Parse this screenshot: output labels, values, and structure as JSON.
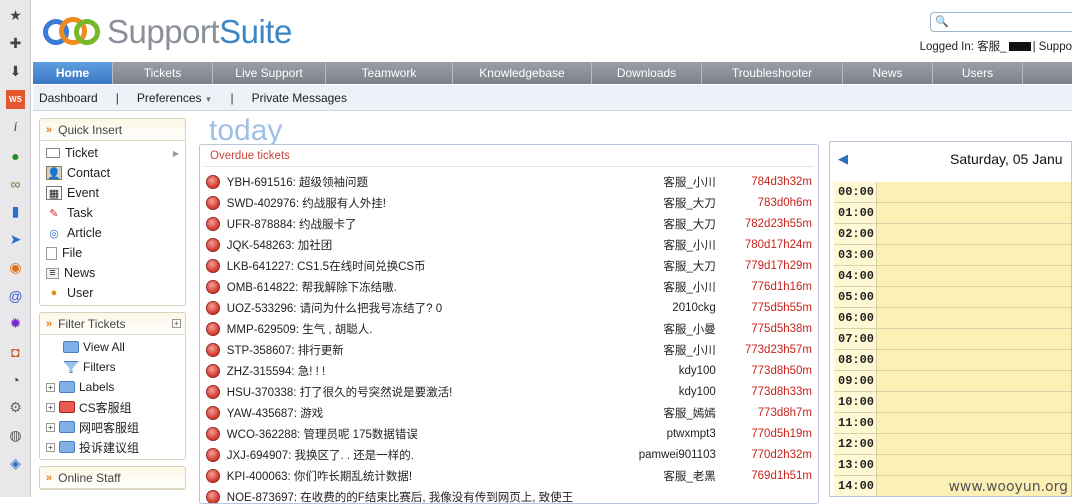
{
  "brand": {
    "name_a": "Support",
    "name_b": "Suite"
  },
  "header": {
    "search_placeholder": "",
    "logged_in_label": "Logged In: 客服_",
    "logged_in_tail": "| Suppo"
  },
  "nav": {
    "tabs": [
      "Home",
      "Tickets",
      "Live Support",
      "Teamwork",
      "Knowledgebase",
      "Downloads",
      "Troubleshooter",
      "News",
      "Users"
    ]
  },
  "subnav": {
    "items": [
      "Dashboard",
      "Preferences",
      "Private Messages"
    ]
  },
  "quick_insert": {
    "title": "Quick Insert",
    "items": [
      "Ticket",
      "Contact",
      "Event",
      "Task",
      "Article",
      "File",
      "News",
      "User"
    ]
  },
  "filter_tickets": {
    "title": "Filter Tickets",
    "items": [
      "View All",
      "Filters",
      "Labels",
      "CS客服组",
      "网吧客服组",
      "投诉建议组"
    ]
  },
  "online_staff": {
    "title": "Online Staff"
  },
  "main": {
    "heading": "today",
    "overdue_title": "Overdue tickets"
  },
  "tickets": [
    {
      "subject": "YBH-691516: 超级领袖问题",
      "owner": "客服_小川",
      "due": "784d3h32m"
    },
    {
      "subject": "SWD-402976: 约战服有人外挂!",
      "owner": "客服_大刀",
      "due": "783d0h6m"
    },
    {
      "subject": "UFR-878884: 约战服卡了",
      "owner": "客服_大刀",
      "due": "782d23h55m"
    },
    {
      "subject": "JQK-548263: 加社团",
      "owner": "客服_小川",
      "due": "780d17h24m"
    },
    {
      "subject": "LKB-641227: CS1.5在线时间兑换CS币",
      "owner": "客服_大刀",
      "due": "779d17h29m"
    },
    {
      "subject": "OMB-614822: 帮我解除下冻结嗷.",
      "owner": "客服_小川",
      "due": "776d1h16m"
    },
    {
      "subject": "UOZ-533296: 请问为什么把我号冻结了? 0",
      "owner": "2010ckg",
      "due": "775d5h55m"
    },
    {
      "subject": "MMP-629509: 生气 , 胡聪人.",
      "owner": "客服_小曼",
      "due": "775d5h38m"
    },
    {
      "subject": "STP-358607: 排行更新",
      "owner": "客服_小川",
      "due": "773d23h57m"
    },
    {
      "subject": "ZHZ-315594: 急! ! !",
      "owner": "kdy100",
      "due": "773d8h50m"
    },
    {
      "subject": "HSU-370338: 打了很久的号突然说是要激活!",
      "owner": "kdy100",
      "due": "773d8h33m"
    },
    {
      "subject": "YAW-435687: 游戏",
      "owner": "客服_嫣嫣",
      "due": "773d8h7m"
    },
    {
      "subject": "WCO-362288: 管理员呢 175数据错误",
      "owner": "ptwxmpt3",
      "due": "770d5h19m"
    },
    {
      "subject": "JXJ-694907: 我换区了. . 还是一样的.",
      "owner": "pamwei901103",
      "due": "770d2h32m"
    },
    {
      "subject": "KPI-400063: 你们咋长期乱统计数据!",
      "owner": "客服_老黑",
      "due": "769d1h51m"
    },
    {
      "subject": "NOE-873697: 在收费的的F结束比赛后, 我像没有传到网页上, 致使王",
      "owner": "",
      "due": ""
    }
  ],
  "calendar": {
    "date": "Saturday, 05 Janu",
    "hours": [
      "00:00",
      "01:00",
      "02:00",
      "03:00",
      "04:00",
      "05:00",
      "06:00",
      "07:00",
      "08:00",
      "09:00",
      "10:00",
      "11:00",
      "12:00",
      "13:00",
      "14:00"
    ]
  },
  "watermark": "www.wooyun.org",
  "colors": {
    "accent": "#3a78c4",
    "overdue": "#c8231a",
    "calendar_slot": "#fdf0b4"
  }
}
